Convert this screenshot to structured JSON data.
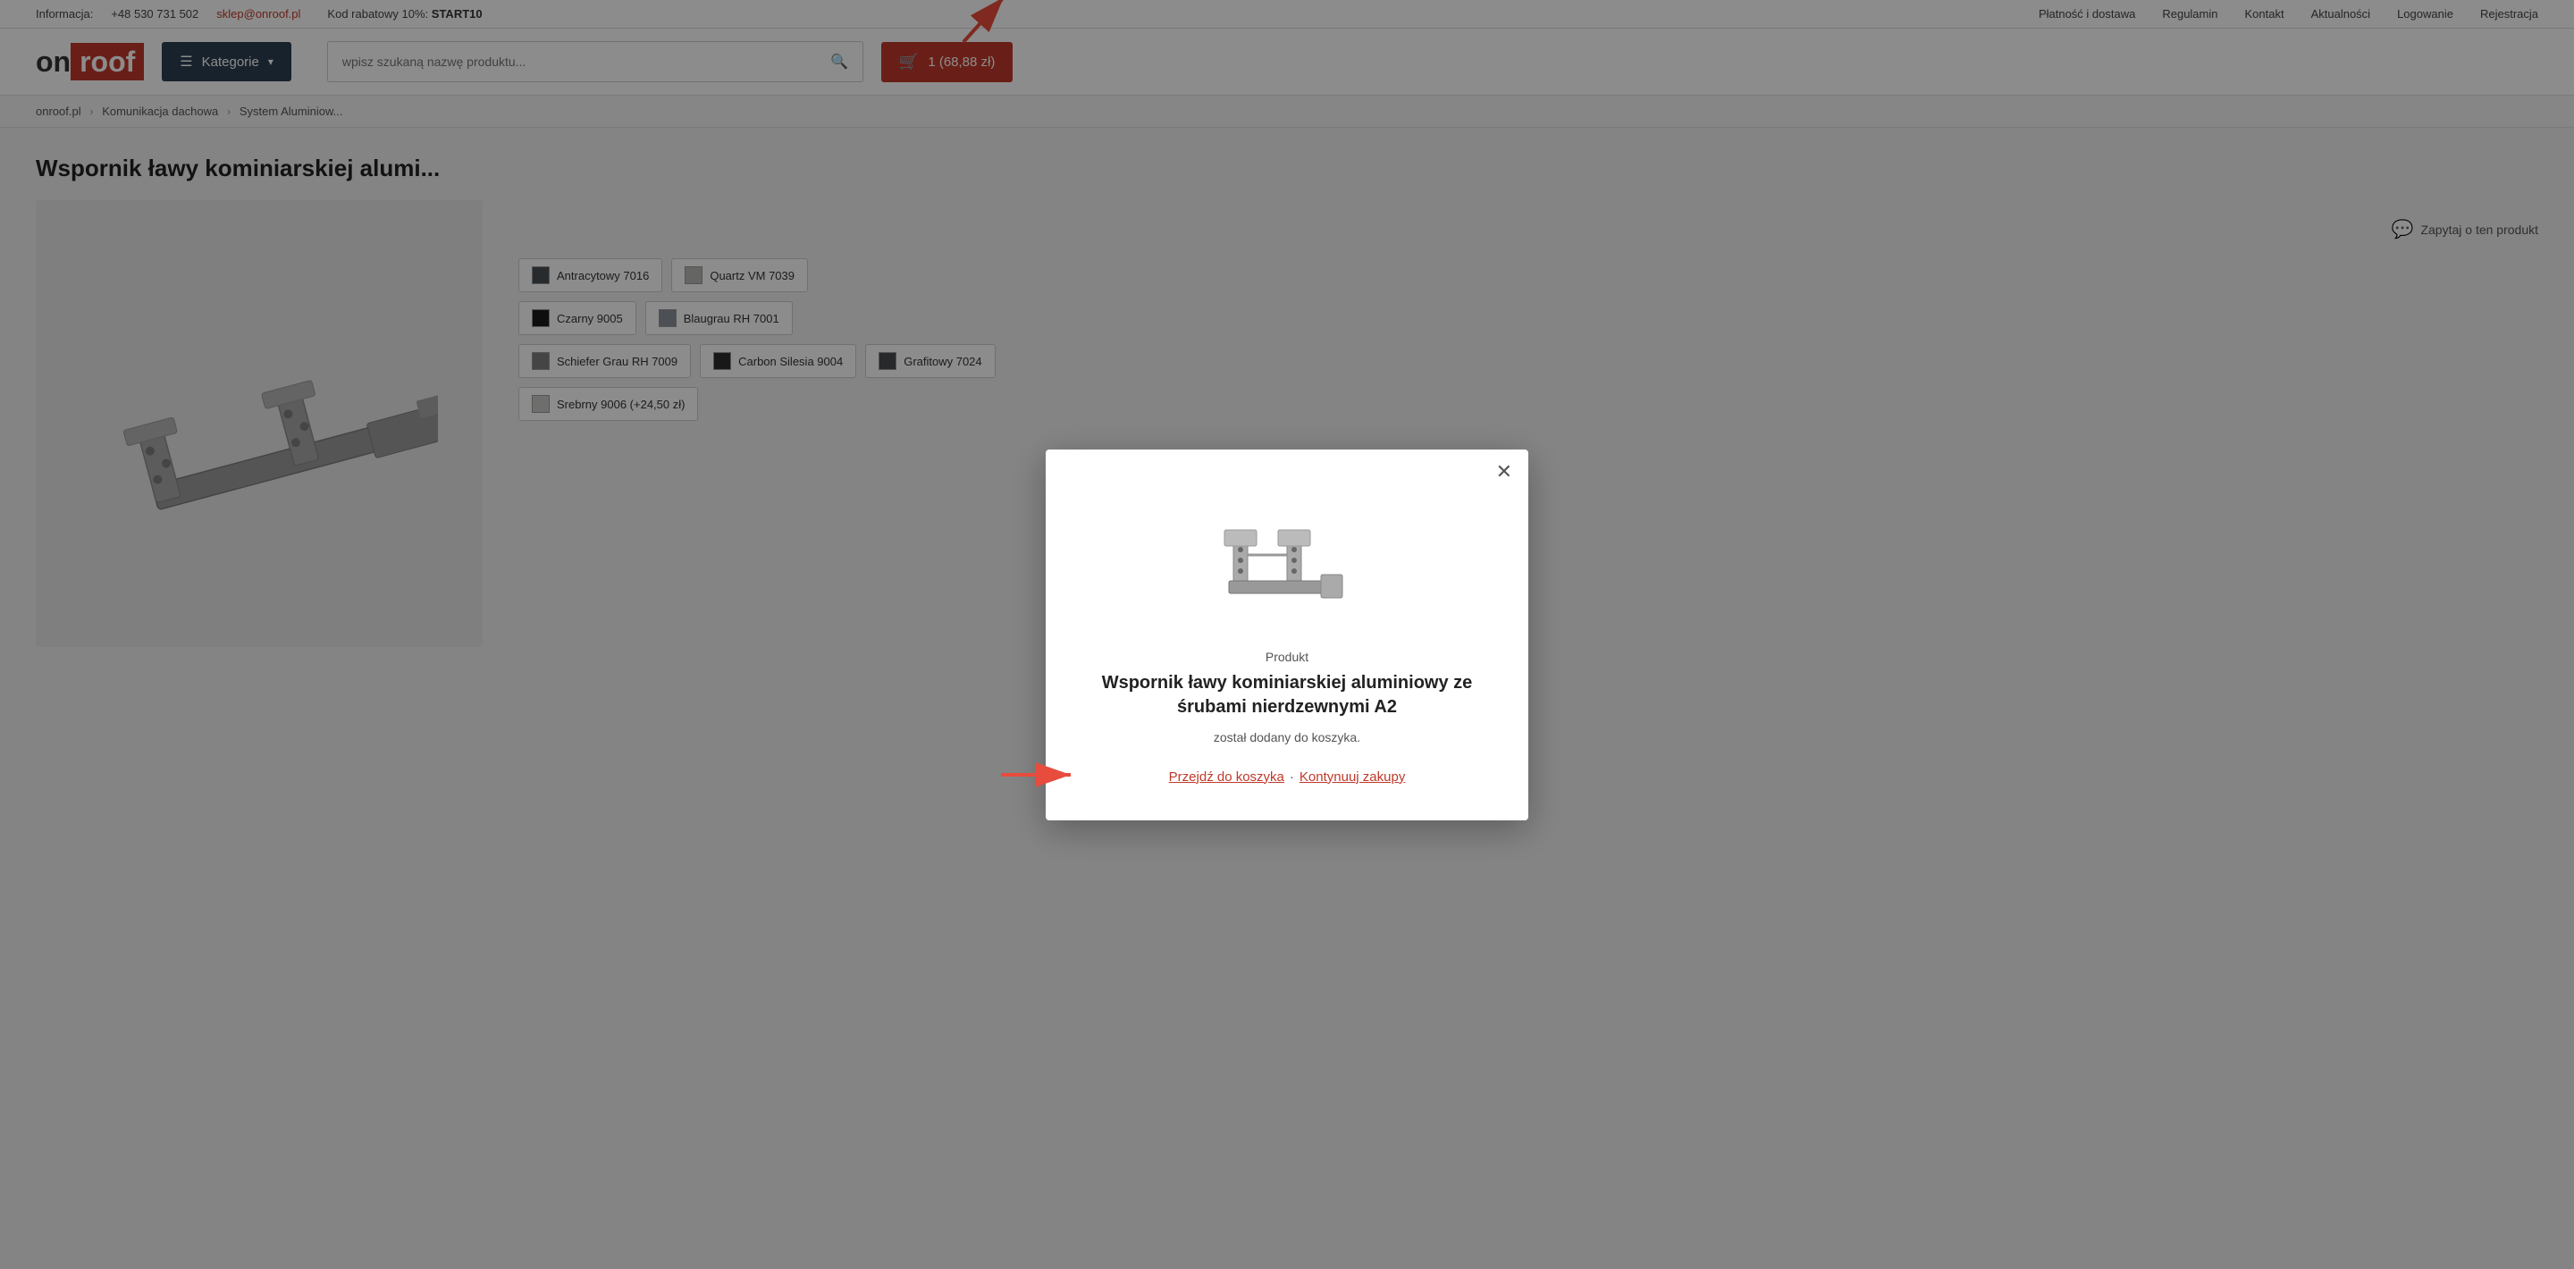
{
  "topbar": {
    "info_label": "Informacja:",
    "phone": "+48 530 731 502",
    "email": "sklep@onroof.pl",
    "promo_text": "Kod rabatowy 10%: ",
    "promo_code": "START10",
    "right_links": [
      {
        "label": "Płatność i dostawa",
        "href": "#"
      },
      {
        "label": "Regulamin",
        "href": "#"
      },
      {
        "label": "Kontakt",
        "href": "#"
      },
      {
        "label": "Aktualności",
        "href": "#"
      },
      {
        "label": "Logowanie",
        "href": "#"
      },
      {
        "label": "Rejestracja",
        "href": "#"
      }
    ]
  },
  "header": {
    "logo_on": "on",
    "logo_roof": "roof",
    "kategorie_label": "Kategorie",
    "search_placeholder": "wpisz szukaną nazwę produktu...",
    "cart_label": "1  (68,88 zł)"
  },
  "breadcrumb": {
    "items": [
      {
        "label": "onroof.pl",
        "href": "#"
      },
      {
        "label": "Komunikacja dachowa",
        "href": "#"
      },
      {
        "label": "System Aluminiow...",
        "href": "#"
      }
    ]
  },
  "product": {
    "title": "Wspornik ławy kominiarskiej alumi...",
    "ask_label": "Zapytaj o ten produkt",
    "colors": [
      {
        "label": "Antracytowy 7016",
        "color": "#4a4f54"
      },
      {
        "label": "Quartz VM 7039",
        "color": "#b8bab5"
      },
      {
        "label": "Czarny 9005",
        "color": "#1a1a1a"
      },
      {
        "label": "Blaugrau RH 7001",
        "color": "#8a9099"
      },
      {
        "label": "Schiefer Grau RH 7009",
        "color": "#7d7f7c"
      },
      {
        "label": "Carbon Silesia 9004",
        "color": "#2c2c2c"
      },
      {
        "label": "Grafitowy 7024",
        "color": "#474b4e"
      },
      {
        "label": "Srebrny 9006 (+24,50 zł)",
        "color": "#c8c9c7"
      }
    ]
  },
  "modal": {
    "label": "Produkt",
    "product_name": "Wspornik ławy kominiarskiej aluminiowy ze śrubami nierdzewnymi A2",
    "added_text": "został dodany do koszyka.",
    "go_to_cart_label": "Przejdź do koszyka",
    "continue_label": "Kontynuuj zakupy",
    "separator": "·"
  }
}
